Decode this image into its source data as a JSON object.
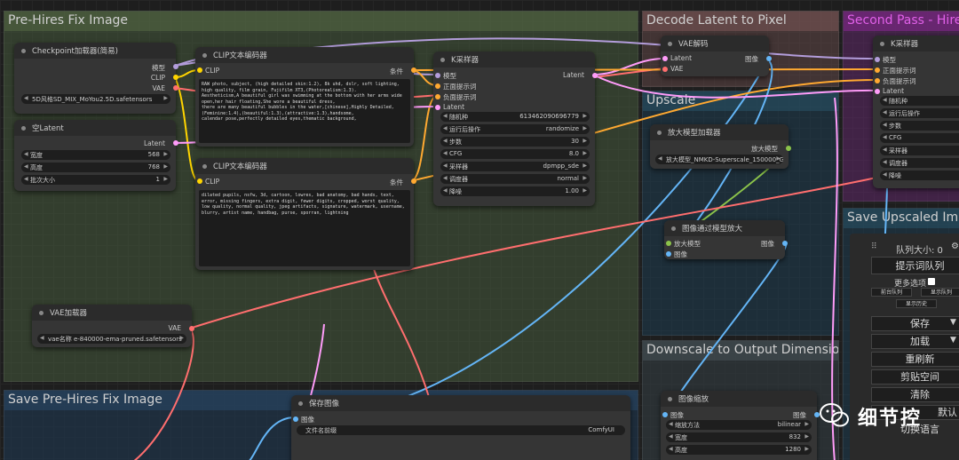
{
  "groups": {
    "pre_hires": "Pre-Hires Fix Image",
    "decode": "Decode Latent to Pixel",
    "second_pass": "Second Pass - Hires",
    "upscale": "Upscale",
    "save_upscaled": "Save Upscaled Imag",
    "downscale": "Downscale to Output Dimension",
    "save_pre_hires": "Save Pre-Hires Fix Image"
  },
  "checkpoint": {
    "title": "Checkpoint加载器(简易)",
    "out_model": "模型",
    "out_clip": "CLIP",
    "out_vae": "VAE",
    "ckpt_name": "5D风格SD_MIX_MoYou2.5D.safetensors"
  },
  "empty_latent": {
    "title": "空Latent",
    "out": "Latent",
    "width_label": "宽度",
    "width": "568",
    "height_label": "高度",
    "height": "768",
    "batch_label": "批次大小",
    "batch": "1"
  },
  "clip_pos": {
    "title": "CLIP文本编码器",
    "in_clip": "CLIP",
    "out": "条件",
    "text": "RAW photo, subject, (high detailed skin:1.2), 8k uhd, dslr, soft lighting, high quality, film grain, Fujifilm XT3,(Photorealism:1.3).\nAestheticism,A beautiful girl was swimming at the bottom with her arms wide open,her hair floating,She wore a beautiful dress,\nthere are many beautiful bubbles in the water,[chinese],Highly Detailed,(Feminine:1.4),(beautiful:1.3),(attractive:1.3),handsome,\ncalendar pose,perfectly detailed eyes,thematic background,"
  },
  "clip_neg": {
    "title": "CLIP文本编码器",
    "in_clip": "CLIP",
    "out": "条件",
    "text": "dilated pupils, nsfw, 3d, cartoon, lowres, bad anatomy, bad hands, text, error, missing fingers, extra digit, fewer digits, cropped, worst quality, low quality, normal quality, jpeg artifacts, signature, watermark, username, blurry, artist name, handbag, purse, sporran, lightning"
  },
  "ksampler": {
    "title": "K采样器",
    "in_model": "模型",
    "in_pos": "正面提示词",
    "in_neg": "负面提示词",
    "in_latent": "Latent",
    "out": "Latent",
    "seed_label": "随机种",
    "seed": "613462090696779",
    "control_label": "运行后操作",
    "control": "randomize",
    "steps_label": "步数",
    "steps": "30",
    "cfg_label": "CFG",
    "cfg": "8.0",
    "sampler_label": "采样器",
    "sampler": "dpmpp_sde",
    "scheduler_label": "调度器",
    "scheduler": "normal",
    "denoise_label": "降噪",
    "denoise": "1.00"
  },
  "vae_decode": {
    "title": "VAE解码",
    "in_latent": "Latent",
    "in_vae": "VAE",
    "out": "图像"
  },
  "ksampler2": {
    "title": "K采样器",
    "in_model": "模型",
    "in_pos": "正面提示词",
    "in_neg": "负面提示词",
    "in_latent": "Latent",
    "w1": "随机种",
    "w2": "运行后操作",
    "w3": "步数",
    "w4": "CFG",
    "w5": "采样器",
    "w6": "调度器",
    "w7": "降噪"
  },
  "upscale_loader": {
    "title": "放大模型加载器",
    "out": "放大模型",
    "model": "放大模型_NMKD-Superscale_150000_G.pth"
  },
  "upscale_image": {
    "title": "图像通过模型放大",
    "in_model": "放大模型",
    "in_image": "图像",
    "out": "图像"
  },
  "vae_loader": {
    "title": "VAE加载器",
    "out": "VAE",
    "vae_name": "vae名称 e-840000-ema-pruned.safetensors"
  },
  "save_image": {
    "title": "保存图像",
    "in_image": "图像",
    "prefix_label": "文件名前缀",
    "prefix": "ComfyUI"
  },
  "image_scale": {
    "title": "图像缩放",
    "in_image": "图像",
    "out": "图像",
    "method_label": "缩放方法",
    "method": "bilinear",
    "width_label": "宽度",
    "width": "832",
    "height_label": "高度",
    "height": "1280"
  },
  "panel": {
    "queue_size": "队列大小: 0",
    "queue_prompt": "提示词队列",
    "more_options": "更多选项",
    "front_queue": "前台队列",
    "show_queue": "显示队列",
    "show_history": "显示历史",
    "save": "保存",
    "load": "加载",
    "refresh": "重刷新",
    "clipspace": "剪贴空间",
    "clear": "清除",
    "default": "默认",
    "switch_lang": "切换语言"
  },
  "watermark": "细节控",
  "colors": {
    "model": "#b39ddb",
    "clip": "#ffd500",
    "vae": "#ff6e6e",
    "latent": "#ff9cf9",
    "conditioning": "#ffa931",
    "image": "#64b5f6",
    "upscale_model": "#8bc34a"
  }
}
